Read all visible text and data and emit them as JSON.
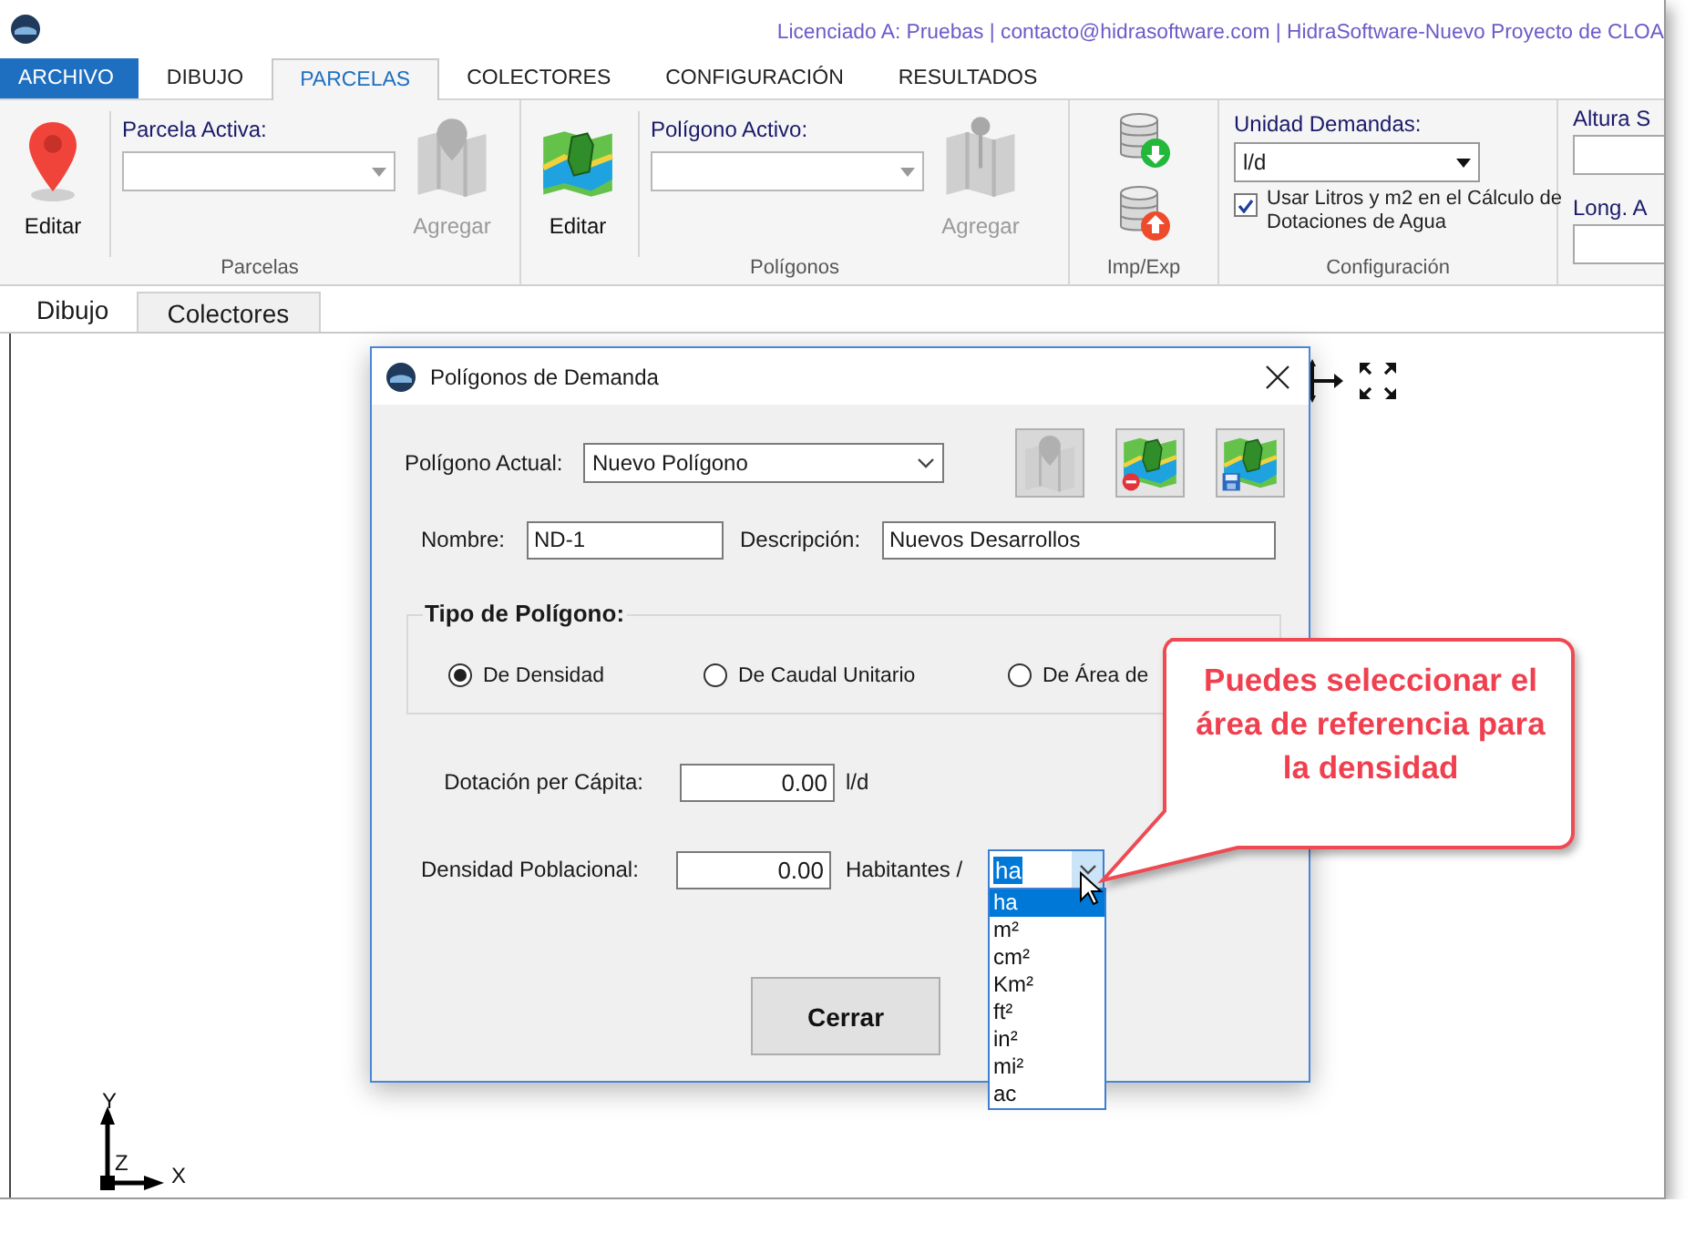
{
  "app": {
    "title": "Licenciado A: Pruebas | contacto@hidrasoftware.com | HidraSoftware-Nuevo Proyecto de CLOA"
  },
  "menu_tabs": [
    {
      "label": "ARCHIVO",
      "kind": "file",
      "selected": false
    },
    {
      "label": "DIBUJO",
      "kind": "tab",
      "selected": false
    },
    {
      "label": "PARCELAS",
      "kind": "tab",
      "selected": true
    },
    {
      "label": "COLECTORES",
      "kind": "tab",
      "selected": false
    },
    {
      "label": "CONFIGURACIÓN",
      "kind": "tab",
      "selected": false
    },
    {
      "label": "RESULTADOS",
      "kind": "tab",
      "selected": false
    }
  ],
  "ribbon": {
    "parcelas": {
      "title": "Parcelas",
      "edit_label": "Editar",
      "active_label": "Parcela Activa:",
      "add_label": "Agregar",
      "add_disabled": true
    },
    "poligonos": {
      "title": "Polígonos",
      "edit_label": "Editar",
      "active_label": "Polígono Activo:",
      "add_label": "Agregar",
      "add_disabled": true
    },
    "imp_exp": {
      "title": "Imp/Exp"
    },
    "configuracion": {
      "title": "Configuración",
      "unit_label": "Unidad Demandas:",
      "unit_value": "l/d",
      "checkbox": {
        "label": "Usar Litros y m2 en el Cálculo de Dotaciones de Agua",
        "checked": true
      }
    },
    "cut_group": {
      "labels": [
        "Altura S",
        "Long. A"
      ]
    }
  },
  "doc_tabs": [
    {
      "label": "Dibujo",
      "selected": true
    },
    {
      "label": "Colectores",
      "selected": false
    }
  ],
  "canvas": {
    "axes": {
      "x": "X",
      "y": "Y",
      "z": "Z"
    }
  },
  "dialog": {
    "title": "Polígonos de Demanda",
    "current_label": "Polígono Actual:",
    "current_value": "Nuevo Polígono",
    "icon_buttons": [
      {
        "kind": "map",
        "disabled": true
      },
      {
        "kind": "delete",
        "disabled": false
      },
      {
        "kind": "save",
        "disabled": false
      }
    ],
    "name_label": "Nombre:",
    "name_value": "ND-1",
    "desc_label": "Descripción:",
    "desc_value": "Nuevos Desarrollos",
    "type_title": "Tipo de Polígono:",
    "types": [
      {
        "label": "De Densidad",
        "selected": true
      },
      {
        "label": "De Caudal Unitario",
        "selected": false
      },
      {
        "label": "De Área de",
        "selected": false
      }
    ],
    "dotacion_label": "Dotación per Cápita:",
    "dotacion_value": "0.00",
    "dotacion_unit": "l/d",
    "densidad_label": "Densidad Poblacional:",
    "densidad_value": "0.00",
    "densidad_unit": "Habitantes /",
    "area_unit": {
      "value": "ha",
      "options": [
        {
          "label": "ha",
          "selected": true
        },
        {
          "label": "m²",
          "selected": false
        },
        {
          "label": "cm²",
          "selected": false
        },
        {
          "label": "Km²",
          "selected": false
        },
        {
          "label": "ft²",
          "selected": false
        },
        {
          "label": "in²",
          "selected": false
        },
        {
          "label": "mi²",
          "selected": false
        },
        {
          "label": "ac",
          "selected": false
        }
      ]
    },
    "close_button": "Cerrar"
  },
  "callout": {
    "text": "Puedes seleccionar el área de referencia para la densidad"
  }
}
